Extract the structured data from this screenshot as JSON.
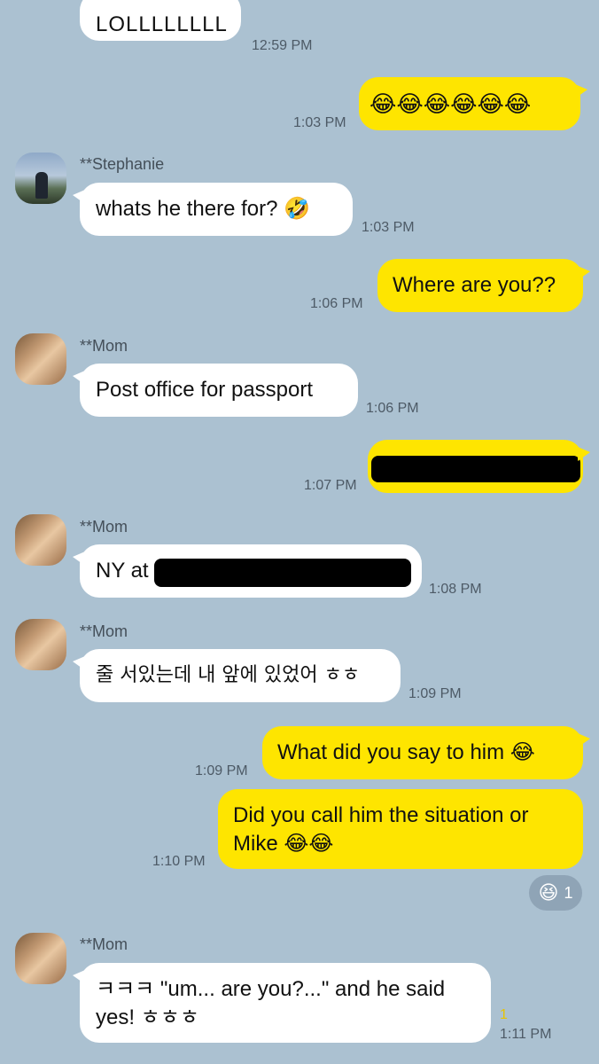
{
  "chat": {
    "messages": [
      {
        "text": "LOLLLLLLLL",
        "time": "12:59 PM"
      },
      {
        "emoji": "😂😂😂😂😂😂",
        "time": "1:03 PM"
      },
      {
        "sender": "**Stephanie",
        "text": "whats he there for? 🤣",
        "time": "1:03 PM"
      },
      {
        "text": "Where are you??",
        "time": "1:06 PM"
      },
      {
        "sender": "**Mom",
        "text": "Post office for passport",
        "time": "1:06 PM"
      },
      {
        "time": "1:07 PM"
      },
      {
        "sender": "**Mom",
        "text": "NY at",
        "time": "1:08 PM"
      },
      {
        "sender": "**Mom",
        "text": "줄 서있는데 내 앞에 있었어 ㅎㅎ",
        "time": "1:09 PM"
      },
      {
        "text": "What did you say to him 😂",
        "time": "1:09 PM"
      },
      {
        "line1": "Did you call him the situation or",
        "line2": "Mike 😂😂",
        "time": "1:10 PM"
      },
      {
        "sender": "**Mom",
        "line1": "ㅋㅋㅋ \"um... are you?...\" and he said",
        "line2": "yes!  ㅎㅎㅎ",
        "time": "1:11 PM",
        "unread": "1"
      }
    ],
    "reaction": {
      "emoji": "😆",
      "count": "1"
    }
  },
  "colors": {
    "background": "#abc1d1",
    "outgoing": "#fee500",
    "incoming": "#ffffff"
  }
}
